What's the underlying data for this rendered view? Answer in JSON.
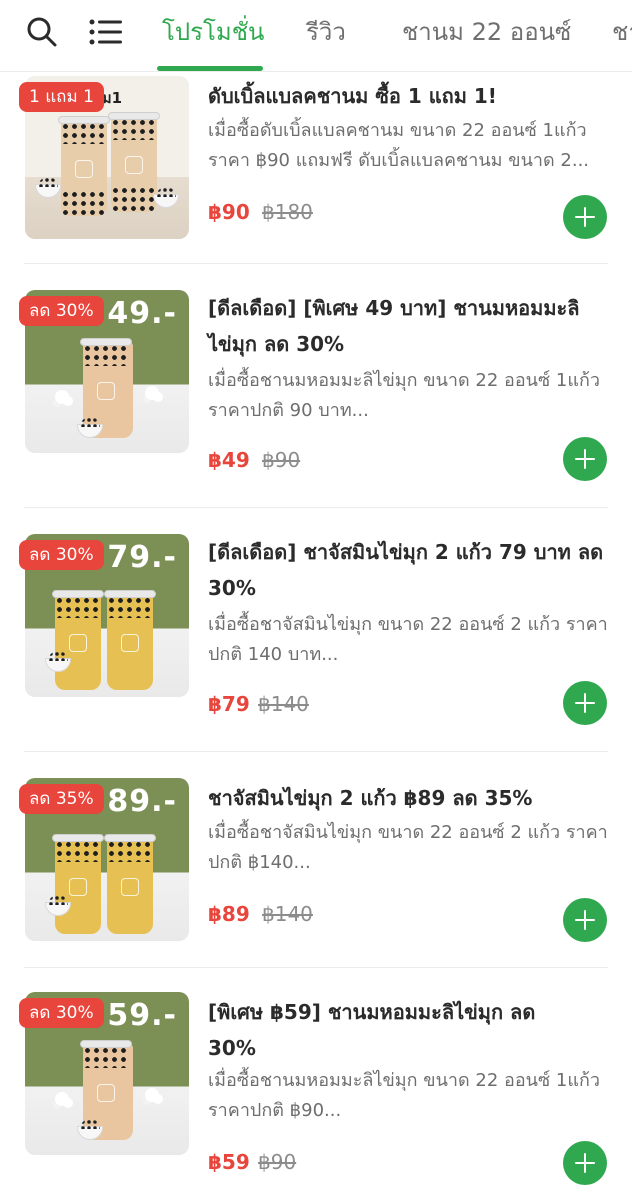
{
  "header": {
    "search_icon": "search-icon",
    "menu_icon": "list-menu-icon",
    "tabs": [
      {
        "label": "โปรโมชั่น",
        "active": true
      },
      {
        "label": "รีวิว",
        "active": false
      },
      {
        "label": "ชานม 22 ออนซ์",
        "active": false
      },
      {
        "label": "ชา",
        "active": false
      }
    ],
    "accent_color": "#2fa84f"
  },
  "items": [
    {
      "badge": "1 แถม 1",
      "thumb_text": "แถม1",
      "title": "ดับเบิ้ลแบลคชานม ซื้อ 1 แถม 1!",
      "description": "เมื่อซื้อดับเบิ้ลแบลคชานม ขนาด 22 ออนซ์ 1แก้ว ราคา ฿90 แถมฟรี ดับเบิ้ลแบลคชานม ขนาด 2...",
      "price": "฿90",
      "old_price": "฿180"
    },
    {
      "badge": "ลด 30%",
      "thumb_text": "49.-",
      "title": "[ดีลเดือด] [พิเศษ 49 บาท] ชานมหอมมะลิไข่มุก ลด 30%",
      "description": "เมื่อซื้อชานมหอมมะลิไข่มุก ขนาด 22 ออนซ์ 1แก้ว  ราคาปกติ 90 บาท...",
      "price": "฿49",
      "old_price": "฿90"
    },
    {
      "badge": "ลด 30%",
      "thumb_text": "79.-",
      "title": "[ดีลเดือด] ชาจัสมินไข่มุก 2 แก้ว 79 บาท ลด 30%",
      "description": "เมื่อซื้อชาจัสมินไข่มุก ขนาด 22 ออนซ์ 2 แก้ว ราคาปกติ 140 บาท...",
      "price": "฿79",
      "old_price": "฿140"
    },
    {
      "badge": "ลด 35%",
      "thumb_text": "89.-",
      "title": "ชาจัสมินไข่มุก 2 แก้ว ฿89 ลด 35%",
      "description": "เมื่อซื้อชาจัสมินไข่มุก ขนาด 22 ออนซ์ 2 แก้ว ราคาปกติ ฿140...",
      "price": "฿89",
      "old_price": "฿140"
    },
    {
      "badge": "ลด 30%",
      "thumb_text": "59.-",
      "title": "[พิเศษ ฿59] ชานมหอมมะลิไข่มุก ลด 30%",
      "description": "เมื่อซื้อชานมหอมมะลิไข่มุก ขนาด 22 ออนซ์ 1แก้ว  ราคาปกติ ฿90...",
      "price": "฿59",
      "old_price": "฿90"
    }
  ],
  "colors": {
    "price": "#e8453c",
    "badge": "#e8453c",
    "add_button": "#2fa84f"
  }
}
